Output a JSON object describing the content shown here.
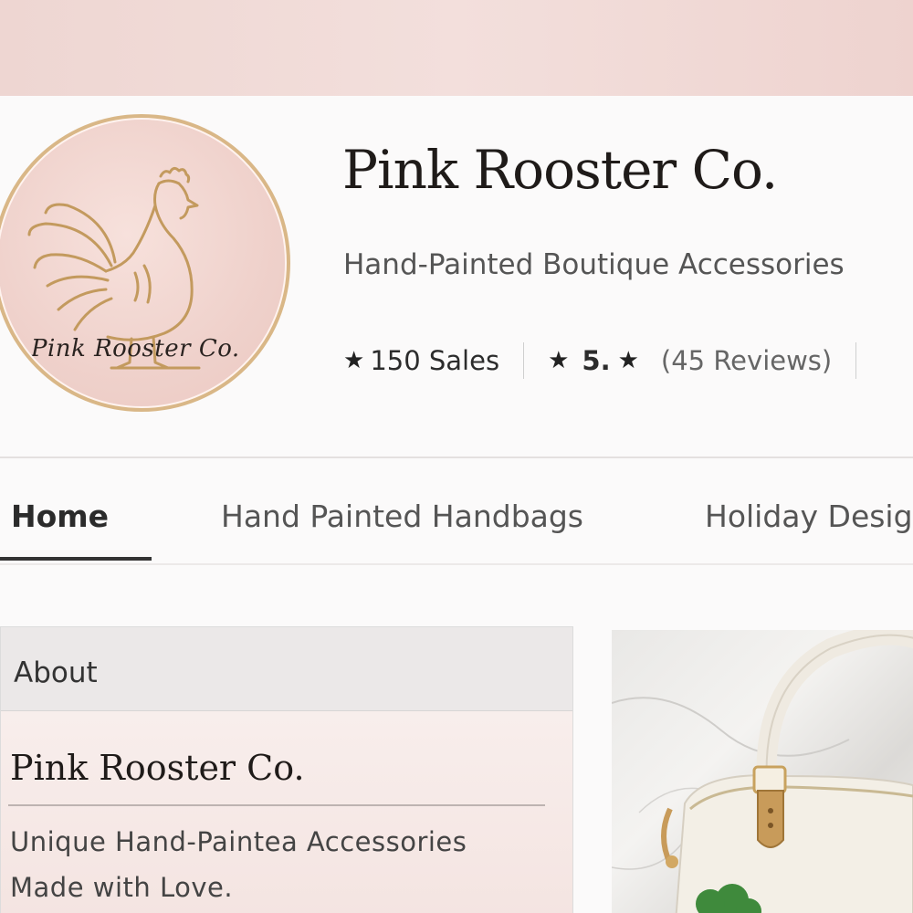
{
  "shop": {
    "logo_text": "Pink Rooster Co.",
    "name": "Pink Rooster Co.",
    "tagline": "Hand-Painted Boutique Accessories",
    "sales": "150 Sales",
    "rating": "5.",
    "reviews": "(45 Reviews)"
  },
  "tabs": [
    {
      "label": "Home",
      "active": true
    },
    {
      "label": "Hand Painted Handbags",
      "active": false
    },
    {
      "label": "Holiday Desig",
      "active": false
    }
  ],
  "about": {
    "header": "About",
    "title": "Pink Rooster Co.",
    "description": "Unique Hand-Paintea  Accessories Made with Love."
  },
  "icons": {
    "star": "star-icon",
    "logo": "rooster-logo",
    "product": "handbag-image"
  },
  "colors": {
    "background": "#f1dcd8",
    "logo_gold": "#c9a067",
    "logo_pink": "#efd1cb",
    "text_dark": "#1f1b19"
  }
}
